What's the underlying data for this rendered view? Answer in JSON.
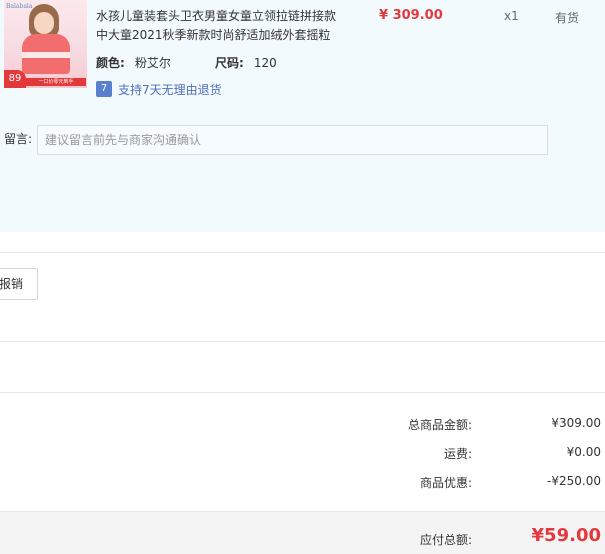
{
  "product": {
    "thumbnail_icon": "product-thumbnail-image",
    "thumb_logo": "Balabala",
    "thumb_ribbon": "一口价零元到手",
    "thumb_badge": "89",
    "title": "水孩儿童装套头卫衣男童女童立领拉链拼接款中大童2021秋季新款时尚舒适加绒外套摇粒",
    "price": "¥ 309.00",
    "quantity": "x1",
    "stock_status": "有货",
    "color_label": "颜色:",
    "color_value": "粉艾尔",
    "size_label": "尺码:",
    "size_value": "120",
    "return_icon_glyph": "7",
    "return_policy": "支持7天无理由退货"
  },
  "memo": {
    "label": "留言:",
    "placeholder": "建议留言前先与商家沟通确认",
    "value": ""
  },
  "invoice": {
    "button_label": "报销"
  },
  "summary": {
    "goods_total_label": "总商品金额:",
    "goods_total_value": "¥309.00",
    "shipping_label": "运费:",
    "shipping_value": "¥0.00",
    "discount_label": "商品优惠:",
    "discount_value": "-¥250.00",
    "payable_label": "应付总额:",
    "payable_value": "¥59.00"
  },
  "colors": {
    "accent_red": "#e4393c",
    "panel_bg": "#f2fafe",
    "link_blue": "#4f6fb8"
  }
}
